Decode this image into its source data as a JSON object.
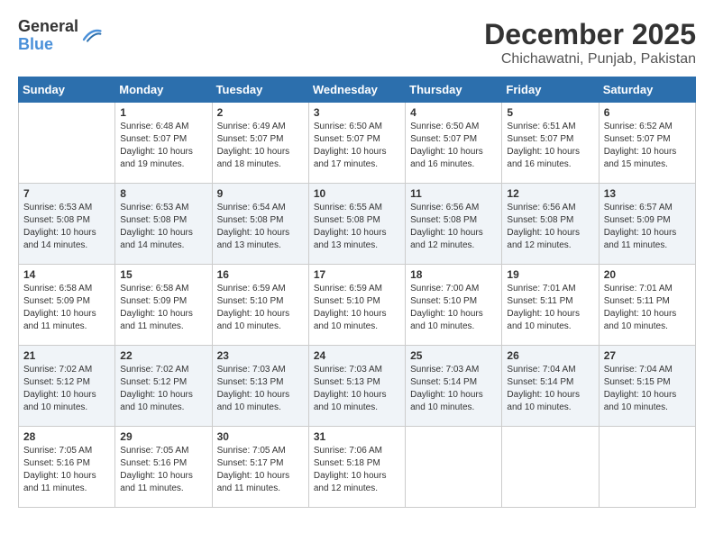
{
  "logo": {
    "general": "General",
    "blue": "Blue"
  },
  "title": {
    "month": "December 2025",
    "location": "Chichawatni, Punjab, Pakistan"
  },
  "headers": [
    "Sunday",
    "Monday",
    "Tuesday",
    "Wednesday",
    "Thursday",
    "Friday",
    "Saturday"
  ],
  "weeks": [
    [
      {
        "num": "",
        "info": ""
      },
      {
        "num": "1",
        "info": "Sunrise: 6:48 AM\nSunset: 5:07 PM\nDaylight: 10 hours\nand 19 minutes."
      },
      {
        "num": "2",
        "info": "Sunrise: 6:49 AM\nSunset: 5:07 PM\nDaylight: 10 hours\nand 18 minutes."
      },
      {
        "num": "3",
        "info": "Sunrise: 6:50 AM\nSunset: 5:07 PM\nDaylight: 10 hours\nand 17 minutes."
      },
      {
        "num": "4",
        "info": "Sunrise: 6:50 AM\nSunset: 5:07 PM\nDaylight: 10 hours\nand 16 minutes."
      },
      {
        "num": "5",
        "info": "Sunrise: 6:51 AM\nSunset: 5:07 PM\nDaylight: 10 hours\nand 16 minutes."
      },
      {
        "num": "6",
        "info": "Sunrise: 6:52 AM\nSunset: 5:07 PM\nDaylight: 10 hours\nand 15 minutes."
      }
    ],
    [
      {
        "num": "7",
        "info": "Sunrise: 6:53 AM\nSunset: 5:08 PM\nDaylight: 10 hours\nand 14 minutes."
      },
      {
        "num": "8",
        "info": "Sunrise: 6:53 AM\nSunset: 5:08 PM\nDaylight: 10 hours\nand 14 minutes."
      },
      {
        "num": "9",
        "info": "Sunrise: 6:54 AM\nSunset: 5:08 PM\nDaylight: 10 hours\nand 13 minutes."
      },
      {
        "num": "10",
        "info": "Sunrise: 6:55 AM\nSunset: 5:08 PM\nDaylight: 10 hours\nand 13 minutes."
      },
      {
        "num": "11",
        "info": "Sunrise: 6:56 AM\nSunset: 5:08 PM\nDaylight: 10 hours\nand 12 minutes."
      },
      {
        "num": "12",
        "info": "Sunrise: 6:56 AM\nSunset: 5:08 PM\nDaylight: 10 hours\nand 12 minutes."
      },
      {
        "num": "13",
        "info": "Sunrise: 6:57 AM\nSunset: 5:09 PM\nDaylight: 10 hours\nand 11 minutes."
      }
    ],
    [
      {
        "num": "14",
        "info": "Sunrise: 6:58 AM\nSunset: 5:09 PM\nDaylight: 10 hours\nand 11 minutes."
      },
      {
        "num": "15",
        "info": "Sunrise: 6:58 AM\nSunset: 5:09 PM\nDaylight: 10 hours\nand 11 minutes."
      },
      {
        "num": "16",
        "info": "Sunrise: 6:59 AM\nSunset: 5:10 PM\nDaylight: 10 hours\nand 10 minutes."
      },
      {
        "num": "17",
        "info": "Sunrise: 6:59 AM\nSunset: 5:10 PM\nDaylight: 10 hours\nand 10 minutes."
      },
      {
        "num": "18",
        "info": "Sunrise: 7:00 AM\nSunset: 5:10 PM\nDaylight: 10 hours\nand 10 minutes."
      },
      {
        "num": "19",
        "info": "Sunrise: 7:01 AM\nSunset: 5:11 PM\nDaylight: 10 hours\nand 10 minutes."
      },
      {
        "num": "20",
        "info": "Sunrise: 7:01 AM\nSunset: 5:11 PM\nDaylight: 10 hours\nand 10 minutes."
      }
    ],
    [
      {
        "num": "21",
        "info": "Sunrise: 7:02 AM\nSunset: 5:12 PM\nDaylight: 10 hours\nand 10 minutes."
      },
      {
        "num": "22",
        "info": "Sunrise: 7:02 AM\nSunset: 5:12 PM\nDaylight: 10 hours\nand 10 minutes."
      },
      {
        "num": "23",
        "info": "Sunrise: 7:03 AM\nSunset: 5:13 PM\nDaylight: 10 hours\nand 10 minutes."
      },
      {
        "num": "24",
        "info": "Sunrise: 7:03 AM\nSunset: 5:13 PM\nDaylight: 10 hours\nand 10 minutes."
      },
      {
        "num": "25",
        "info": "Sunrise: 7:03 AM\nSunset: 5:14 PM\nDaylight: 10 hours\nand 10 minutes."
      },
      {
        "num": "26",
        "info": "Sunrise: 7:04 AM\nSunset: 5:14 PM\nDaylight: 10 hours\nand 10 minutes."
      },
      {
        "num": "27",
        "info": "Sunrise: 7:04 AM\nSunset: 5:15 PM\nDaylight: 10 hours\nand 10 minutes."
      }
    ],
    [
      {
        "num": "28",
        "info": "Sunrise: 7:05 AM\nSunset: 5:16 PM\nDaylight: 10 hours\nand 11 minutes."
      },
      {
        "num": "29",
        "info": "Sunrise: 7:05 AM\nSunset: 5:16 PM\nDaylight: 10 hours\nand 11 minutes."
      },
      {
        "num": "30",
        "info": "Sunrise: 7:05 AM\nSunset: 5:17 PM\nDaylight: 10 hours\nand 11 minutes."
      },
      {
        "num": "31",
        "info": "Sunrise: 7:06 AM\nSunset: 5:18 PM\nDaylight: 10 hours\nand 12 minutes."
      },
      {
        "num": "",
        "info": ""
      },
      {
        "num": "",
        "info": ""
      },
      {
        "num": "",
        "info": ""
      }
    ]
  ]
}
